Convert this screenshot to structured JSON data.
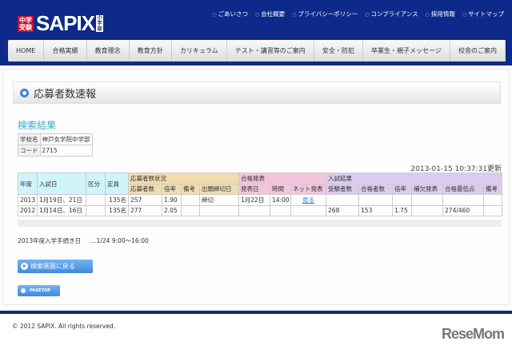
{
  "header": {
    "logo_badge": "中学受験",
    "logo": "SAPIX",
    "logo_sub": "小学部",
    "links": [
      "ごあいさつ",
      "会社概要",
      "プライバシーポリシー",
      "コンプライアンス",
      "採用情報",
      "サイトマップ"
    ]
  },
  "nav": [
    "HOME",
    "合格実績",
    "教育理念",
    "教育方針",
    "カリキュラム",
    "テスト・講習等のご案内",
    "安全・防犯",
    "卒業生・親子メッセージ",
    "校舎のご案内"
  ],
  "page_title": "応募者数速報",
  "section_title": "検索結果",
  "info": [
    {
      "label": "学校名",
      "value": "神戸女学院中学部"
    },
    {
      "label": "コード",
      "value": "2715"
    }
  ],
  "updated": "2013-01-15 10:37:31更新",
  "table": {
    "groups": {
      "applicants": "応募者数状況",
      "announce": "合格発表",
      "results": "入試結果"
    },
    "fixed_headers": [
      "年度",
      "入試日",
      "区分",
      "定員"
    ],
    "sub_headers": [
      "応募者数",
      "倍率",
      "備考",
      "出願締切日",
      "発表日",
      "時間",
      "ネット発表",
      "受験者数",
      "合格者数",
      "倍率",
      "補欠発表",
      "合格最低点",
      "備考"
    ],
    "rows": [
      [
        "2013",
        "1月19日、21日",
        "",
        "135名",
        "257",
        "1.90",
        "",
        "締切",
        "1月22日",
        "14:00",
        "見る",
        "",
        "",
        "",
        "",
        "",
        ""
      ],
      [
        "2012",
        "1月14日、16日",
        "",
        "135名",
        "277",
        "2.05",
        "",
        "",
        "",
        "",
        "",
        "268",
        "153",
        "1.75",
        "",
        "274/460",
        ""
      ]
    ]
  },
  "note": {
    "label": "2013年度入学手続き日",
    "value": "…1/24 9:00～16:00"
  },
  "back_button": "検索画面に戻る",
  "pagetop": "PAGETOP",
  "copyright": "© 2012 SAPIX. All rights reserved.",
  "watermark": "ReseMom"
}
